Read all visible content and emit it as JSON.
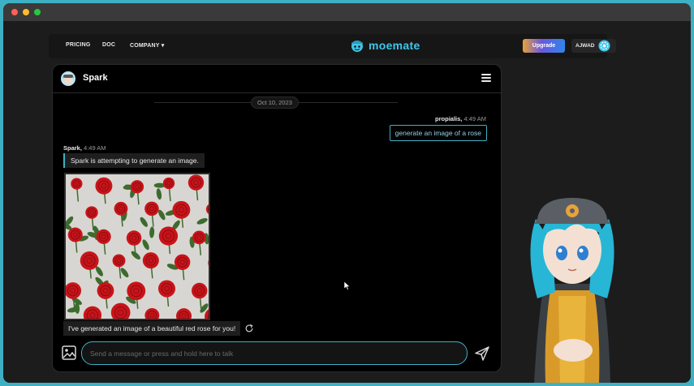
{
  "nav": {
    "links": [
      "PRICING",
      "DOC",
      "COMPANY"
    ],
    "company_caret": "▾",
    "logo_text": "moemate",
    "upgrade_label": "Upgrade",
    "user_name": "AJWAD"
  },
  "chat": {
    "title": "Spark",
    "date": "Oct 10, 2023",
    "messages": [
      {
        "sender": "propialis,",
        "time": "4:49 AM",
        "text": "generate an image of a rose"
      },
      {
        "sender": "Spark,",
        "time": "4:49 AM",
        "text": "Spark is attempting to generate an image."
      },
      {
        "text": "I've generated an image of a beautiful red rose for you!"
      }
    ],
    "input_placeholder": "Send a message or press and hold here to talk"
  },
  "colors": {
    "accent": "#3fb0c4",
    "logo": "#3fc6ea",
    "rose": "#c8141a",
    "leaf": "#3d6b2f"
  },
  "icons": [
    "menu-icon",
    "image-icon",
    "send-icon",
    "regenerate-icon",
    "settings-icon"
  ]
}
